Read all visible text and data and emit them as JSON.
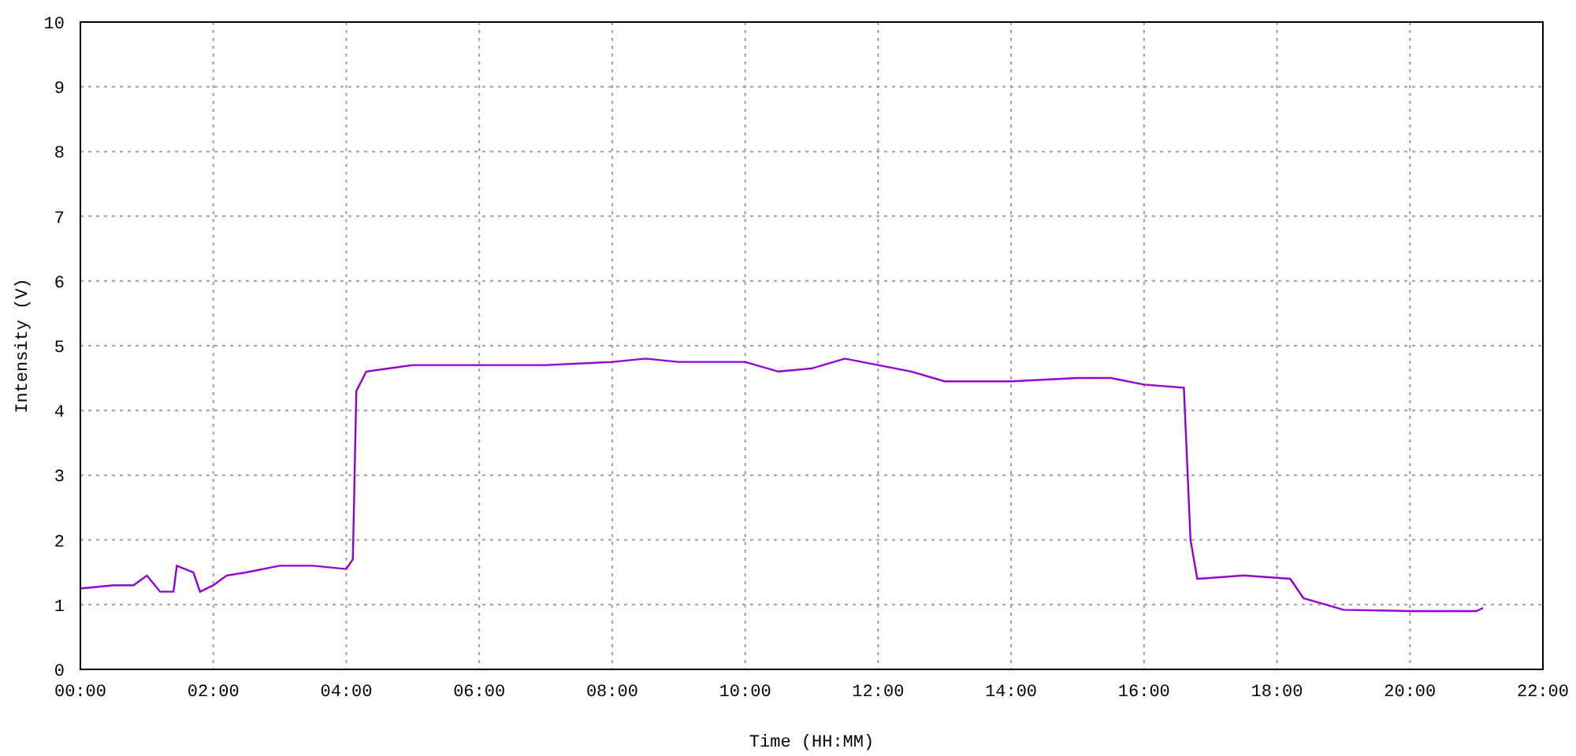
{
  "chart_data": {
    "type": "line",
    "xlabel": "Time (HH:MM)",
    "ylabel": "Intensity (V)",
    "x": [
      0,
      0.5,
      0.8,
      1.0,
      1.2,
      1.4,
      1.45,
      1.7,
      1.8,
      2.0,
      2.2,
      2.5,
      3.0,
      3.5,
      4.0,
      4.1,
      4.15,
      4.3,
      5,
      6,
      7,
      8,
      8.5,
      9,
      10,
      10.5,
      11,
      11.5,
      12,
      12.5,
      13,
      14,
      15,
      15.5,
      16,
      16.6,
      16.7,
      16.8,
      17.5,
      18.2,
      18.4,
      19,
      20,
      21,
      21.1
    ],
    "series": [
      {
        "color": "#9400d3",
        "values": [
          1.25,
          1.3,
          1.3,
          1.45,
          1.2,
          1.2,
          1.6,
          1.5,
          1.2,
          1.3,
          1.45,
          1.5,
          1.6,
          1.6,
          1.55,
          1.7,
          4.3,
          4.6,
          4.7,
          4.7,
          4.7,
          4.75,
          4.8,
          4.75,
          4.75,
          4.6,
          4.65,
          4.8,
          4.7,
          4.6,
          4.45,
          4.45,
          4.5,
          4.5,
          4.4,
          4.35,
          2.0,
          1.4,
          1.45,
          1.4,
          1.1,
          0.92,
          0.9,
          0.9,
          0.95
        ]
      }
    ],
    "xlim": [
      0,
      22
    ],
    "ylim": [
      0,
      10
    ],
    "xticks": [
      {
        "value": 0,
        "label": "00:00"
      },
      {
        "value": 2,
        "label": "02:00"
      },
      {
        "value": 4,
        "label": "04:00"
      },
      {
        "value": 6,
        "label": "06:00"
      },
      {
        "value": 8,
        "label": "08:00"
      },
      {
        "value": 10,
        "label": "10:00"
      },
      {
        "value": 12,
        "label": "12:00"
      },
      {
        "value": 14,
        "label": "14:00"
      },
      {
        "value": 16,
        "label": "16:00"
      },
      {
        "value": 18,
        "label": "18:00"
      },
      {
        "value": 20,
        "label": "20:00"
      },
      {
        "value": 22,
        "label": "22:00"
      }
    ],
    "yticks": [
      0,
      1,
      2,
      3,
      4,
      5,
      6,
      7,
      8,
      9,
      10
    ],
    "grid": true
  }
}
